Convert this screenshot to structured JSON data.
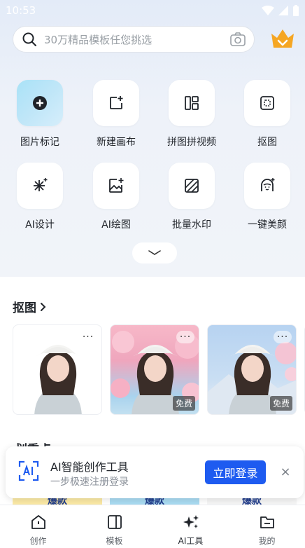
{
  "status_bar": {
    "time": "10:53"
  },
  "search": {
    "placeholder": "30万精品模板任您挑选"
  },
  "tools": [
    {
      "label": "图片标记",
      "icon": "plus-circle-icon"
    },
    {
      "label": "新建画布",
      "icon": "new-canvas-icon"
    },
    {
      "label": "拼图拼视频",
      "icon": "collage-icon"
    },
    {
      "label": "抠图",
      "icon": "cutout-icon"
    },
    {
      "label": "AI设计",
      "icon": "sparkle-icon"
    },
    {
      "label": "AI绘图",
      "icon": "ai-draw-icon"
    },
    {
      "label": "批量水印",
      "icon": "watermark-icon"
    },
    {
      "label": "一键美颜",
      "icon": "beauty-icon"
    }
  ],
  "cutout_section": {
    "title": "抠图",
    "cards": [
      {
        "more": "···",
        "badge": ""
      },
      {
        "more": "···",
        "badge": "免费"
      },
      {
        "more": "···",
        "badge": "免费"
      },
      {
        "more": "",
        "badge": ""
      }
    ]
  },
  "section2": {
    "title": "划重点 ›"
  },
  "peek_cards": [
    "爆款",
    "爆款",
    "爆款"
  ],
  "login_banner": {
    "title": "AI智能创作工具",
    "subtitle": "一步极速注册登录",
    "button": "立即登录",
    "close": "×"
  },
  "bottom_nav": [
    {
      "label": "创作",
      "icon": "home-icon"
    },
    {
      "label": "模板",
      "icon": "template-icon"
    },
    {
      "label": "AI工具",
      "icon": "ai-tools-icon"
    },
    {
      "label": "我的",
      "icon": "folder-icon"
    }
  ],
  "colors": {
    "accent": "#1e5bf0",
    "vip": "#f5a623",
    "highlight_tile": "#bfe6f8"
  }
}
